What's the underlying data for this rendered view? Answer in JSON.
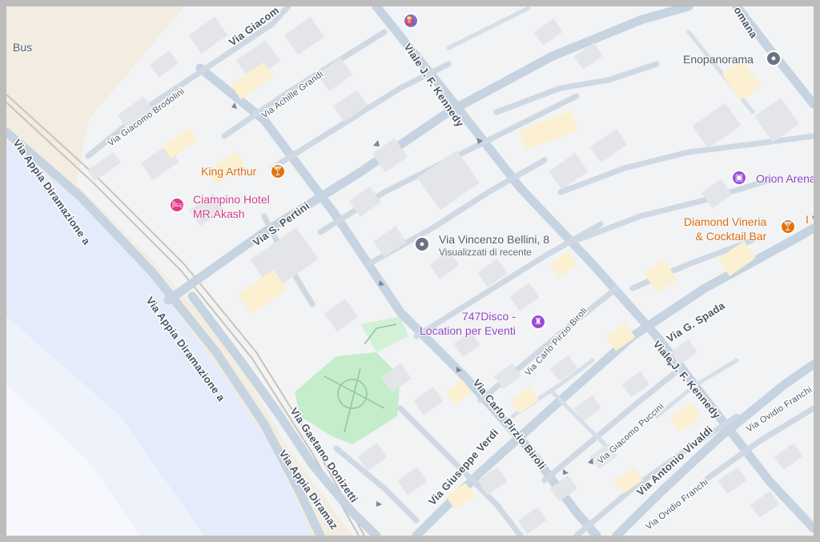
{
  "map": {
    "colors": {
      "background": "#f1f3f4",
      "water": "#e4ecfb",
      "sand": "#f3ece0",
      "park": "#c5eccb",
      "road": "#c6d3e0"
    },
    "streets": {
      "viale_kennedy_n": "Viale J. F. Kennedy",
      "viale_kennedy_s": "Viale J. F. Kennedy",
      "via_giacomo_brodolini": "Via Giacomo Brodolini",
      "via_achille_grandi": "Via Achille Grandi",
      "via_giacomo": "Via Giacom",
      "via_s_pertini": "Via S. Pertini",
      "via_appia_1": "Via Appia Diramazione a",
      "via_appia_2": "Via Appia Diramazione a",
      "via_appia_3": "Via Appia Diramaz",
      "via_gaetano_donizetti": "Via Gaetano Donizetti",
      "via_giuseppe_verdi": "Via Giuseppe Verdi",
      "via_carlo_pirzio_biroli": "Via Carlo Pirzio Biroli",
      "via_carlo_pirzio_biroli_s": "Via Carlo Pirzio Biroli",
      "via_giacomo_puccini": "Via Giacomo Puccini",
      "via_antonio_vivaldi": "Via Antonio Vivaldi",
      "via_ovidio_franchi": "Via Ovidio Franchi",
      "via_ovidio_franchi_e": "Via Ovidio Franchi",
      "via_g_spada": "Via G. Spada",
      "romana": "omana"
    },
    "places": {
      "bus": "Bus",
      "king_arthur": "King Arthur",
      "ciampino_hotel": "Ciampino Hotel\nMR.Akash",
      "enopanorama": "Enopanorama",
      "orion_arena": "Orion Arena",
      "diamond_vineria": "Diamond Vineria\n& Cocktail Bar",
      "iv": "I V",
      "via_vincenzo_bellini": "Via Vincenzo Bellini, 8",
      "visualizzati": "Visualizzati di recente",
      "disco": "747Disco -\nLocation per Eventi"
    },
    "icons": {
      "bar": "cocktail-icon",
      "hotel": "bed-icon",
      "place": "place-pin-icon",
      "arena": "arena-icon",
      "disco": "castle-icon",
      "fuel": "fuel-icon"
    }
  }
}
